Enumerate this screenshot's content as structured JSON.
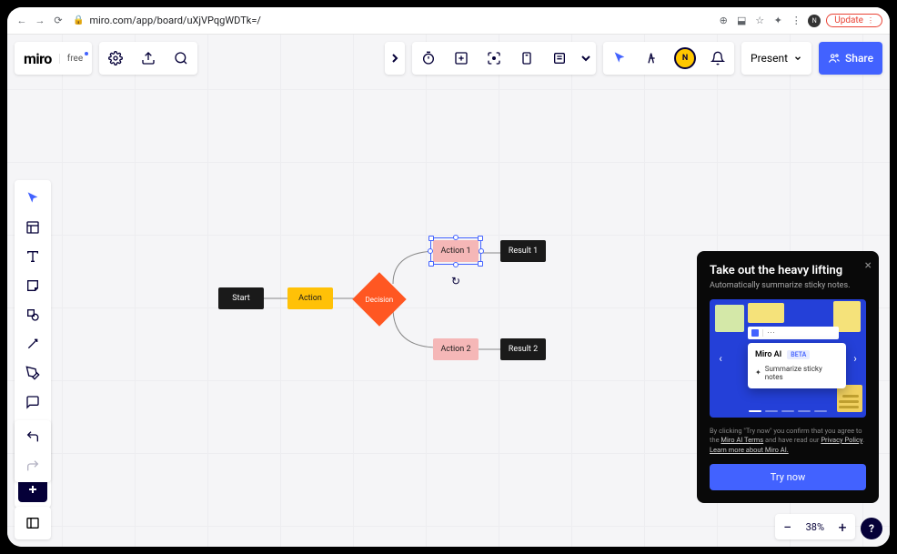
{
  "browser": {
    "url": "miro.com/app/board/uXjVPqgWDTk=/",
    "update_label": "Update"
  },
  "header": {
    "logo": "miro",
    "plan": "free"
  },
  "present": {
    "label": "Present"
  },
  "share": {
    "label": "Share"
  },
  "zoom": {
    "value": "38%"
  },
  "flow": {
    "start": "Start",
    "action": "Action",
    "decision": "Decision",
    "action1": "Action 1",
    "action2": "Action 2",
    "result1": "Result 1",
    "result2": "Result 2"
  },
  "promo": {
    "title": "Take out the heavy lifting",
    "subtitle": "Automatically summarize sticky notes.",
    "card_title": "Miro AI",
    "card_badge": "BETA",
    "card_action": "Summarize sticky notes",
    "legal_prefix": "By clicking \"Try now\" you confirm that you agree to the ",
    "legal_link1": "Miro AI Terms",
    "legal_mid": " and have read our ",
    "legal_link2": "Privacy Policy",
    "legal_sep": ". ",
    "legal_link3": "Learn more about Miro AI.",
    "cta": "Try now"
  }
}
